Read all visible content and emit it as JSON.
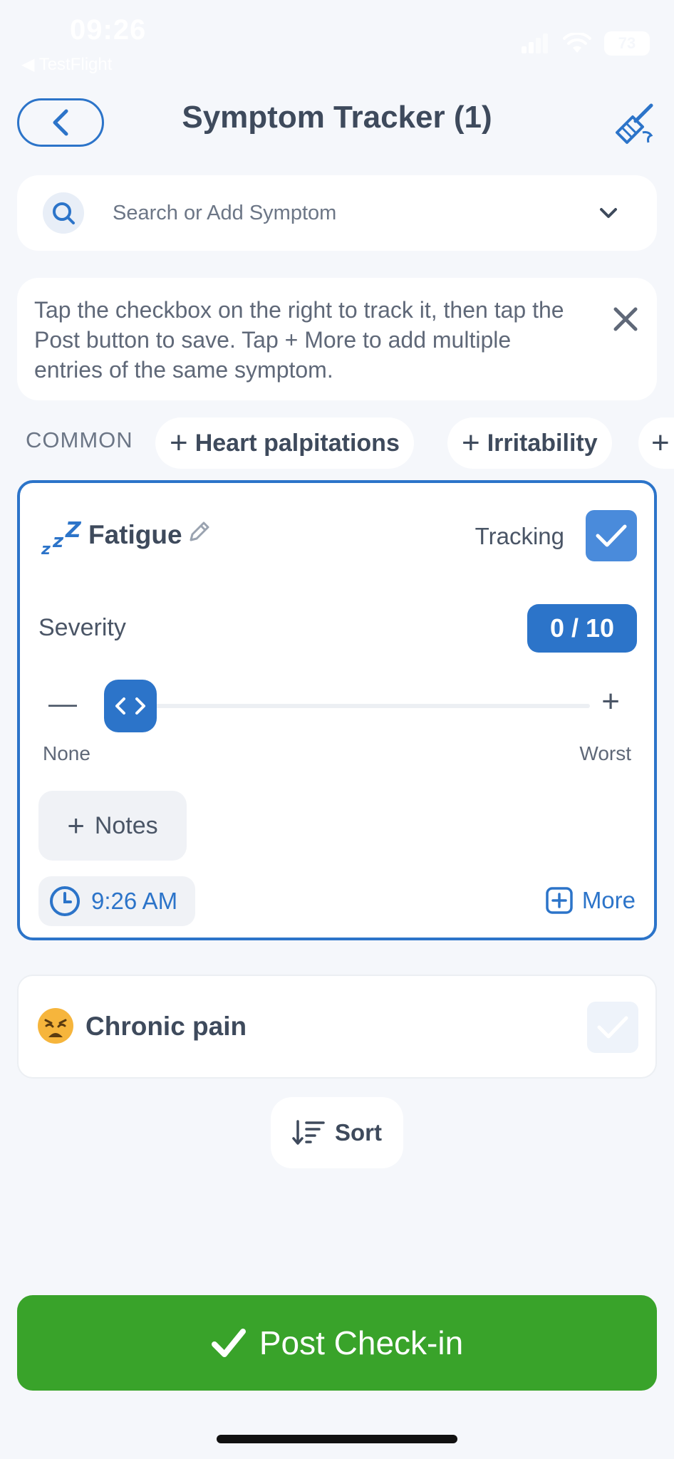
{
  "status_bar": {
    "time": "09:26",
    "back_app": "◀ TestFlight",
    "battery": "73"
  },
  "header": {
    "title": "Symptom Tracker (1)"
  },
  "search": {
    "placeholder": "Search or Add Symptom"
  },
  "tip": {
    "text": "Tap the checkbox on the right to track it, then tap the Post button to save. Tap + More to add multiple entries of the same symptom."
  },
  "common": {
    "label": "COMMON",
    "chips": [
      {
        "label": "Heart palpitations"
      },
      {
        "label": "Irritability"
      }
    ]
  },
  "tracked_symptom": {
    "name": "Fatigue",
    "tracking_label": "Tracking",
    "tracking_checked": true,
    "severity_label": "Severity",
    "severity_value": "0 / 10",
    "severity_level": 0,
    "severity_max": 10,
    "min_label": "None",
    "max_label": "Worst",
    "notes_label": "Notes",
    "time": "9:26 AM",
    "more_label": "More"
  },
  "other_symptom": {
    "name": "Chronic pain",
    "tracking_checked": false
  },
  "sort": {
    "label": "Sort"
  },
  "post": {
    "label": "Post Check-in"
  },
  "colors": {
    "accent": "#2c74c9",
    "post_green": "#39a32a",
    "background": "#f5f7fb"
  }
}
